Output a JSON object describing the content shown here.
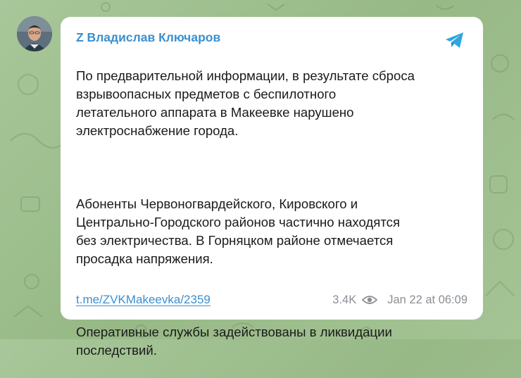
{
  "post": {
    "sender": "Z Владислав Ключаров",
    "paragraphs": [
      "По предварительной информации, в результате сброса\nвзрывоопасных предметов с беспилотного\nлетательного аппарата в Макеевке нарушено\nэлектроснабжение города.",
      "Абоненты Червоногвардейского, Кировского и\nЦентрально-Городского районов частично находятся\nбез электричества. В Горняцком районе отмечается\nпросадка напряжения.",
      "Оперативные службы задействованы в ликвидации\nпоследствий."
    ],
    "link": "t.me/ZVKMakeevka/2359",
    "views": "3.4K",
    "timestamp": "Jan 22 at 06:09"
  },
  "colors": {
    "accent": "#3a8fd0",
    "telegram": "#2ea6e0",
    "background": "#9fbf8f"
  },
  "icons": {
    "avatar": "avatar",
    "telegram": "telegram-icon",
    "views": "eye-icon"
  }
}
